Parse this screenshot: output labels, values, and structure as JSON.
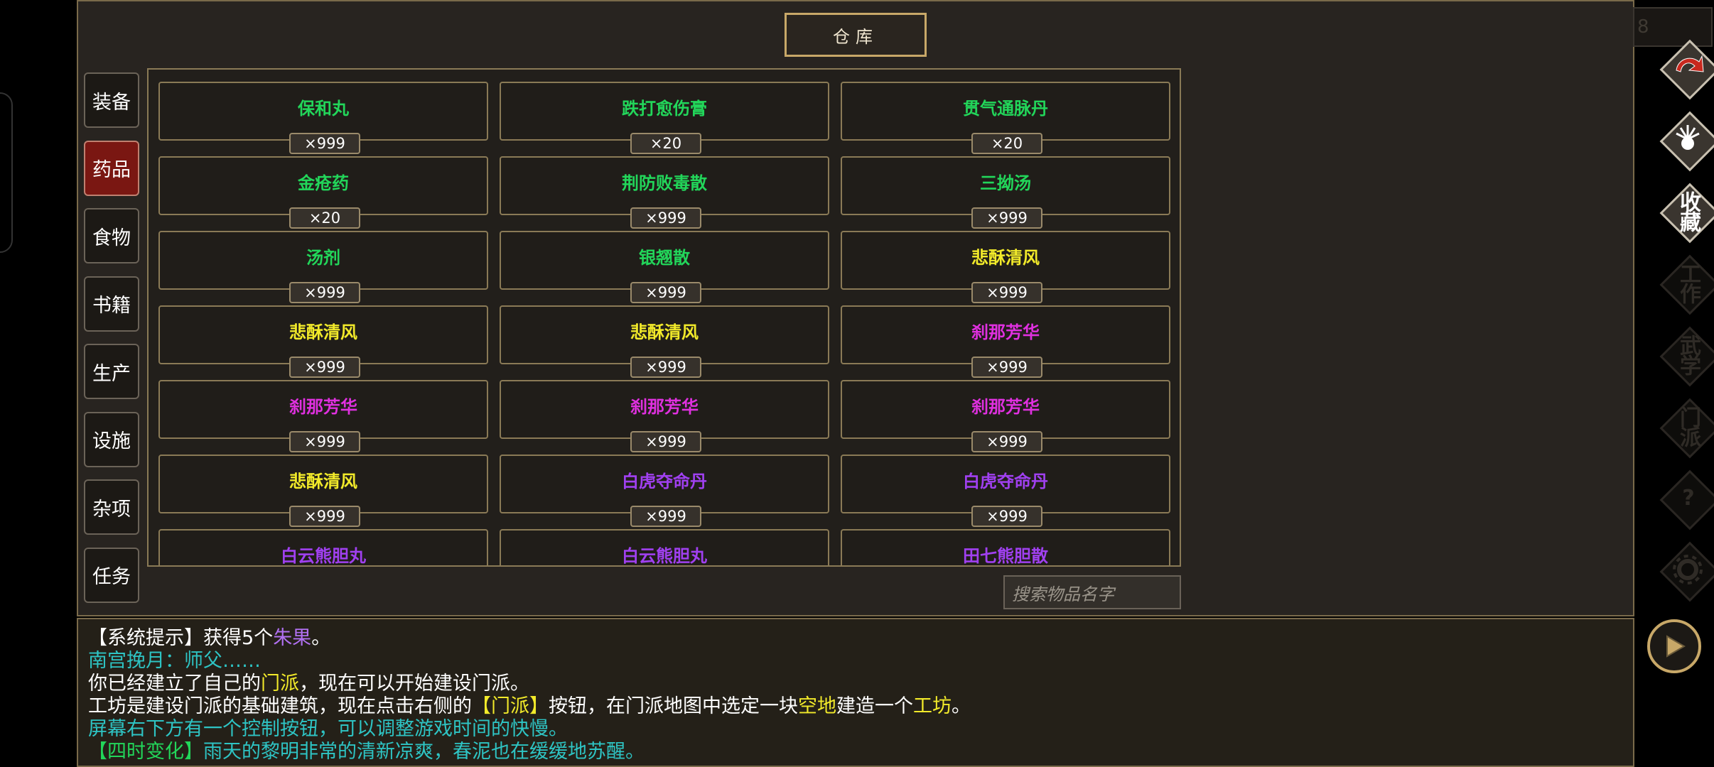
{
  "title": "仓库",
  "categories": [
    {
      "label": "装备",
      "active": false
    },
    {
      "label": "药品",
      "active": true
    },
    {
      "label": "食物",
      "active": false
    },
    {
      "label": "书籍",
      "active": false
    },
    {
      "label": "生产",
      "active": false
    },
    {
      "label": "设施",
      "active": false
    },
    {
      "label": "杂项",
      "active": false
    },
    {
      "label": "任务",
      "active": false
    }
  ],
  "items": [
    {
      "name": "保和丸",
      "qty": "×999",
      "color": "#22d65a"
    },
    {
      "name": "跌打愈伤膏",
      "qty": "×20",
      "color": "#22d65a"
    },
    {
      "name": "贯气通脉丹",
      "qty": "×20",
      "color": "#22d65a"
    },
    {
      "name": "金疮药",
      "qty": "×20",
      "color": "#22d65a"
    },
    {
      "name": "荆防败毒散",
      "qty": "×999",
      "color": "#22d65a"
    },
    {
      "name": "三拗汤",
      "qty": "×999",
      "color": "#22d65a"
    },
    {
      "name": "汤剂",
      "qty": "×999",
      "color": "#22d65a"
    },
    {
      "name": "银翘散",
      "qty": "×999",
      "color": "#22d65a"
    },
    {
      "name": "悲酥清风",
      "qty": "×999",
      "color": "#f2ea2a"
    },
    {
      "name": "悲酥清风",
      "qty": "×999",
      "color": "#f2ea2a"
    },
    {
      "name": "悲酥清风",
      "qty": "×999",
      "color": "#f2ea2a"
    },
    {
      "name": "刹那芳华",
      "qty": "×999",
      "color": "#e030e0"
    },
    {
      "name": "刹那芳华",
      "qty": "×999",
      "color": "#e030e0"
    },
    {
      "name": "刹那芳华",
      "qty": "×999",
      "color": "#e030e0"
    },
    {
      "name": "刹那芳华",
      "qty": "×999",
      "color": "#e030e0"
    },
    {
      "name": "悲酥清风",
      "qty": "×999",
      "color": "#f2ea2a"
    },
    {
      "name": "白虎夺命丹",
      "qty": "×999",
      "color": "#a040f0"
    },
    {
      "name": "白虎夺命丹",
      "qty": "×999",
      "color": "#a040f0"
    },
    {
      "name": "白云熊胆丸",
      "qty": "",
      "color": "#a040f0"
    },
    {
      "name": "白云熊胆丸",
      "qty": "",
      "color": "#a040f0"
    },
    {
      "name": "田七熊胆散",
      "qty": "",
      "color": "#a040f0"
    }
  ],
  "search": {
    "placeholder": "搜索物品名字"
  },
  "top_right_field": "8",
  "log": [
    [
      {
        "t": "【系统提示】获得5个",
        "c": "#ffffff"
      },
      {
        "t": "朱果",
        "c": "#b070f0"
      },
      {
        "t": "。",
        "c": "#ffffff"
      }
    ],
    [
      {
        "t": "南宫挽月：师父……",
        "c": "#2ec4c4"
      }
    ],
    [
      {
        "t": "你已经建立了自己的",
        "c": "#ffffff"
      },
      {
        "t": "门派",
        "c": "#f2ea2a"
      },
      {
        "t": "，现在可以开始建设门派。",
        "c": "#ffffff"
      }
    ],
    [
      {
        "t": "工坊是建设门派的基础建筑，现在点击右侧的",
        "c": "#ffffff"
      },
      {
        "t": "【门派】",
        "c": "#f2ea2a"
      },
      {
        "t": "按钮，在门派地图中选定一块",
        "c": "#ffffff"
      },
      {
        "t": "空地",
        "c": "#f2ea2a"
      },
      {
        "t": "建造一个",
        "c": "#ffffff"
      },
      {
        "t": "工坊",
        "c": "#f2ea2a"
      },
      {
        "t": "。",
        "c": "#ffffff"
      }
    ],
    [
      {
        "t": "屏幕右下方有一个控制按钮，可以调整游戏时间的快慢。",
        "c": "#2ec4c4"
      }
    ],
    [
      {
        "t": "【四时变化】",
        "c": "#22d65a"
      },
      {
        "t": "雨天的黎明非常的清新凉爽，春泥也在缓缓地苏醒。",
        "c": "#2ec4c4"
      }
    ]
  ],
  "side_buttons": [
    {
      "name": "return",
      "label": "",
      "icon": "return-arrow-icon",
      "dim": false
    },
    {
      "name": "character",
      "label": "",
      "icon": "character-icon",
      "dim": false
    },
    {
      "name": "collection",
      "label": "收藏",
      "icon": "",
      "dim": false
    },
    {
      "name": "work",
      "label": "工作",
      "icon": "",
      "dim": true
    },
    {
      "name": "martial",
      "label": "武学",
      "icon": "",
      "dim": true
    },
    {
      "name": "sect",
      "label": "门派",
      "icon": "",
      "dim": true
    },
    {
      "name": "help",
      "label": "?",
      "icon": "",
      "dim": true
    },
    {
      "name": "settings",
      "label": "",
      "icon": "gear-icon",
      "dim": true
    }
  ],
  "colors": {
    "accent": "#c8a868",
    "active_tab": "#7a1712"
  }
}
